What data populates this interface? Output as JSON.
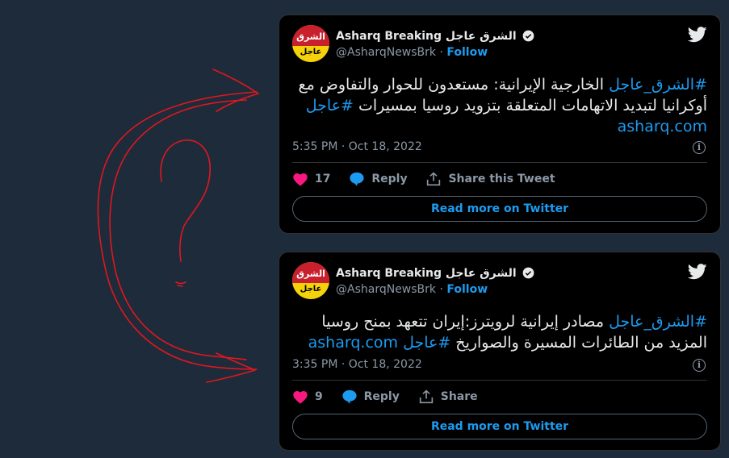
{
  "tweets": [
    {
      "avatar": {
        "top_text": "الشرق",
        "bottom_text": "عاجل"
      },
      "display_name": "Asharq Breaking الشرق عاجل",
      "handle": "@AsharqNewsBrk",
      "separator": "·",
      "follow_label": "Follow",
      "text_hashtag": "#الشرق_عاجل",
      "text_body": " الخارجية الإيرانية: مستعدون للحوار والتفاوض مع أوكرانيا لتبديد الاتهامات المتعلقة بتزويد روسيا بمسيرات ",
      "text_hashtag2": "#عاجل",
      "text_link": "asharq.com",
      "timestamp": "5:35 PM · Oct 18, 2022",
      "likes": "17",
      "reply_label": "Reply",
      "share_label": "Share this Tweet",
      "read_more": "Read more on Twitter"
    },
    {
      "avatar": {
        "top_text": "الشرق",
        "bottom_text": "عاجل"
      },
      "display_name": "Asharq Breaking الشرق عاجل",
      "handle": "@AsharqNewsBrk",
      "separator": "·",
      "follow_label": "Follow",
      "text_hashtag": "#الشرق_عاجل",
      "text_body": " مصادر إيرانية لرويترز:إيران تتعهد بمنح روسيا المزيد من الطائرات المسيرة والصواريخ ",
      "text_hashtag2": "#عاجل",
      "text_link": "asharq.com",
      "timestamp": "3:35 PM · Oct 18, 2022",
      "likes": "9",
      "reply_label": "Reply",
      "share_label": "Share",
      "read_more": "Read more on Twitter"
    }
  ],
  "colors": {
    "page_background": "#1e2b3a",
    "card_background": "#000000",
    "accent": "#1d9bf0",
    "like_heart": "#f91880",
    "scribble": "#e0171f"
  },
  "icons": [
    "twitter-bird-icon",
    "verified-badge-icon",
    "heart-icon",
    "reply-bubble-icon",
    "share-icon",
    "info-icon"
  ]
}
